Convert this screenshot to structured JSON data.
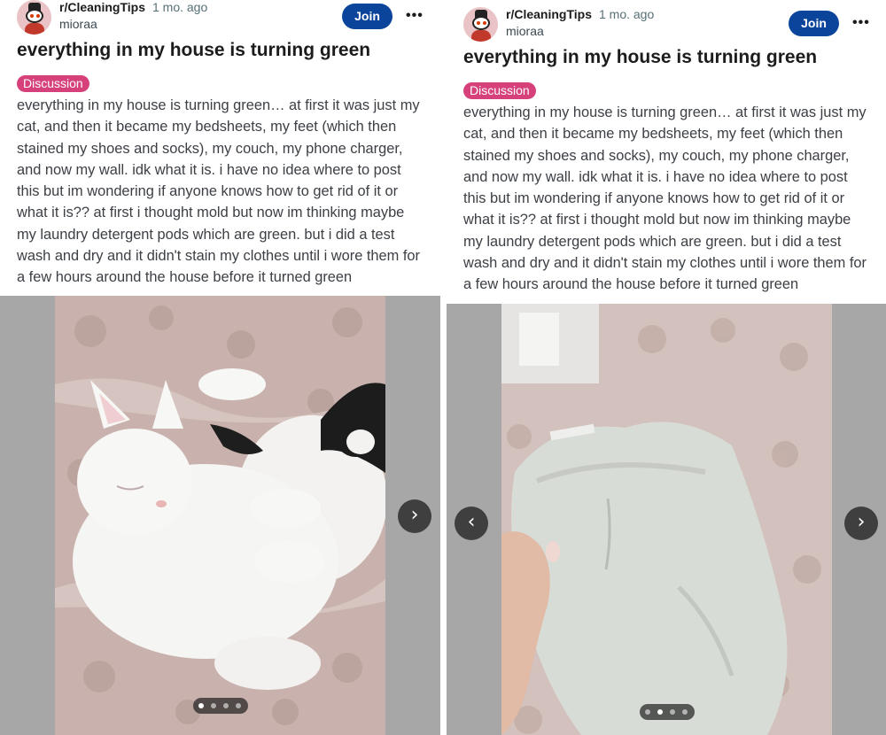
{
  "post": {
    "subreddit": "r/CleaningTips",
    "time": "1 mo. ago",
    "username": "mioraa",
    "join_label": "Join",
    "more_label": "•••",
    "title": "everything in my house is turning green",
    "flair": "Discussion",
    "body": "everything in my house is turning green… at first it was just my cat, and then it became my bedsheets, my feet (which then stained my shoes and socks), my couch, my phone charger, and now my wall. idk what it is. i have no idea where to post this but im wondering if anyone knows how to get rid of it or what it is?? at first i thought mold but now im thinking maybe my laundry detergent pods which are green. but i did a test wash and dry and it didn't stain my clothes until i wore them for a few hours around the house before it turned green"
  },
  "gallery": {
    "image_count": 4,
    "left_panel_active_index": 1,
    "right_panel_active_index": 2,
    "next_icon": "chevron-right-icon",
    "prev_icon": "chevron-left-icon"
  },
  "colors": {
    "join_button": "#0a449b",
    "flair": "#d6417c",
    "gallery_bg": "#a7a7a7"
  }
}
